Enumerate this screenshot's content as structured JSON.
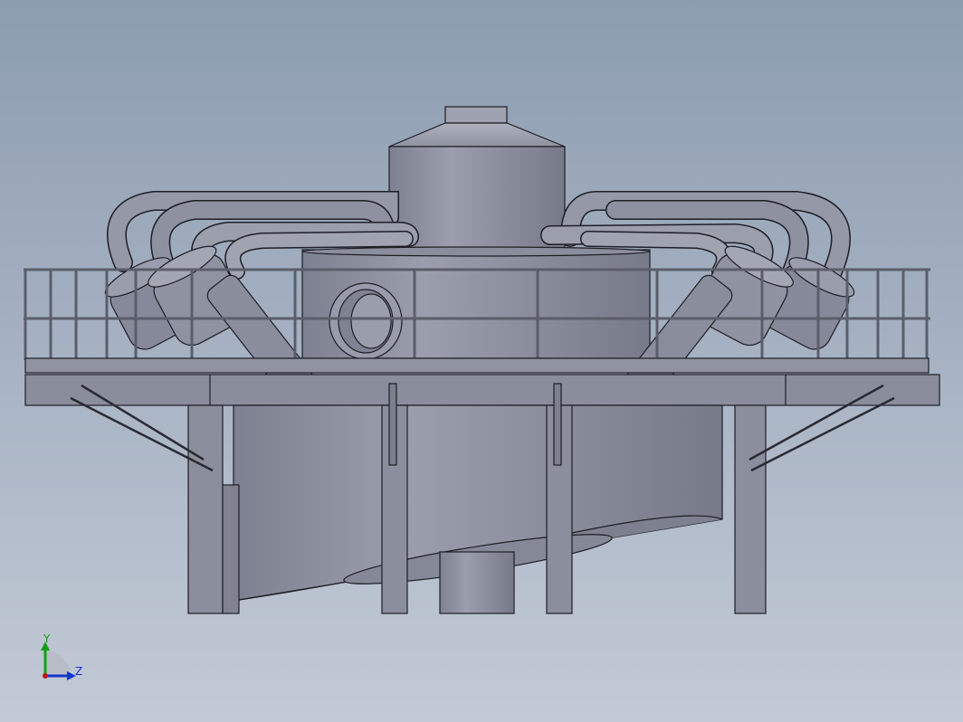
{
  "viewport": {
    "background_top": "#8c9db0",
    "background_bottom": "#c3cad6",
    "model_color": "#8c8f9e",
    "edge_color": "#1e1e26"
  },
  "triad": {
    "y_label": "Y",
    "z_label": "Z",
    "y_color": "#12a012",
    "z_color": "#1535d0",
    "origin_color": "#c01818"
  }
}
